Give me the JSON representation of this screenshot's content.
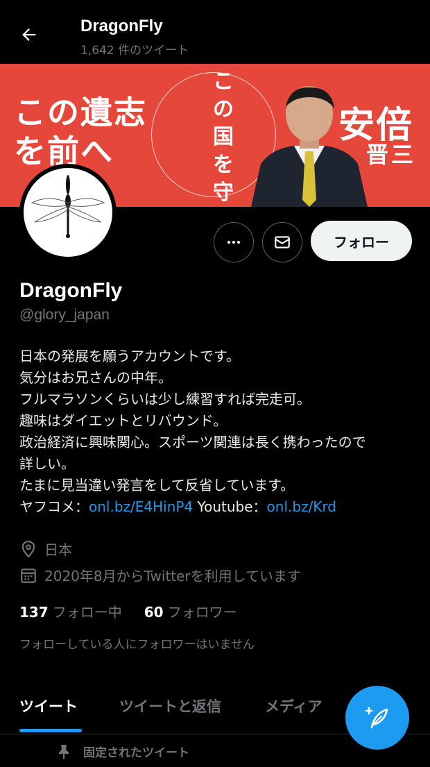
{
  "header": {
    "title": "DragonFly",
    "tweet_count": "1,642 件のツイート"
  },
  "banner": {
    "slogan_line1": "この遺志",
    "slogan_line2": "を前へ",
    "vertical_text": "この国を守る。",
    "name": "安倍",
    "name_sub": "晋三"
  },
  "actions": {
    "more_icon": "more-horizontal-icon",
    "message_icon": "mail-icon",
    "follow_label": "フォロー"
  },
  "profile": {
    "name": "DragonFly",
    "handle": "@glory_japan",
    "bio_lines": [
      "日本の発展を願うアカウントです。",
      "気分はお兄さんの中年。",
      "フルマラソンくらいは少し練習すれば完走可。",
      "趣味はダイエットとリバウンド。",
      "政治経済に興味関心。スポーツ関連は長く携わったので",
      "詳しい。",
      "たまに見当違い発言をして反省しています。"
    ],
    "bio_links_prefix": "ヤフコメ：",
    "bio_link1": "onl.bz/E4HinP4",
    "bio_links_mid": " Youtube：",
    "bio_link2": "onl.bz/Krd",
    "location": "日本",
    "joined": "2020年8月からTwitterを利用しています"
  },
  "stats": {
    "following_count": "137",
    "following_label": "フォロー中",
    "followers_count": "60",
    "followers_label": "フォロワー"
  },
  "followers_note": "フォローしている人にフォロワーはいません",
  "tabs": [
    {
      "label": "ツイート",
      "active": true
    },
    {
      "label": "ツイートと返信",
      "active": false
    },
    {
      "label": "メディア",
      "active": false
    }
  ],
  "pinned_label": "固定されたツイート",
  "colors": {
    "accent": "#1d9bf0",
    "banner": "#e5483b",
    "muted": "#71767b"
  }
}
